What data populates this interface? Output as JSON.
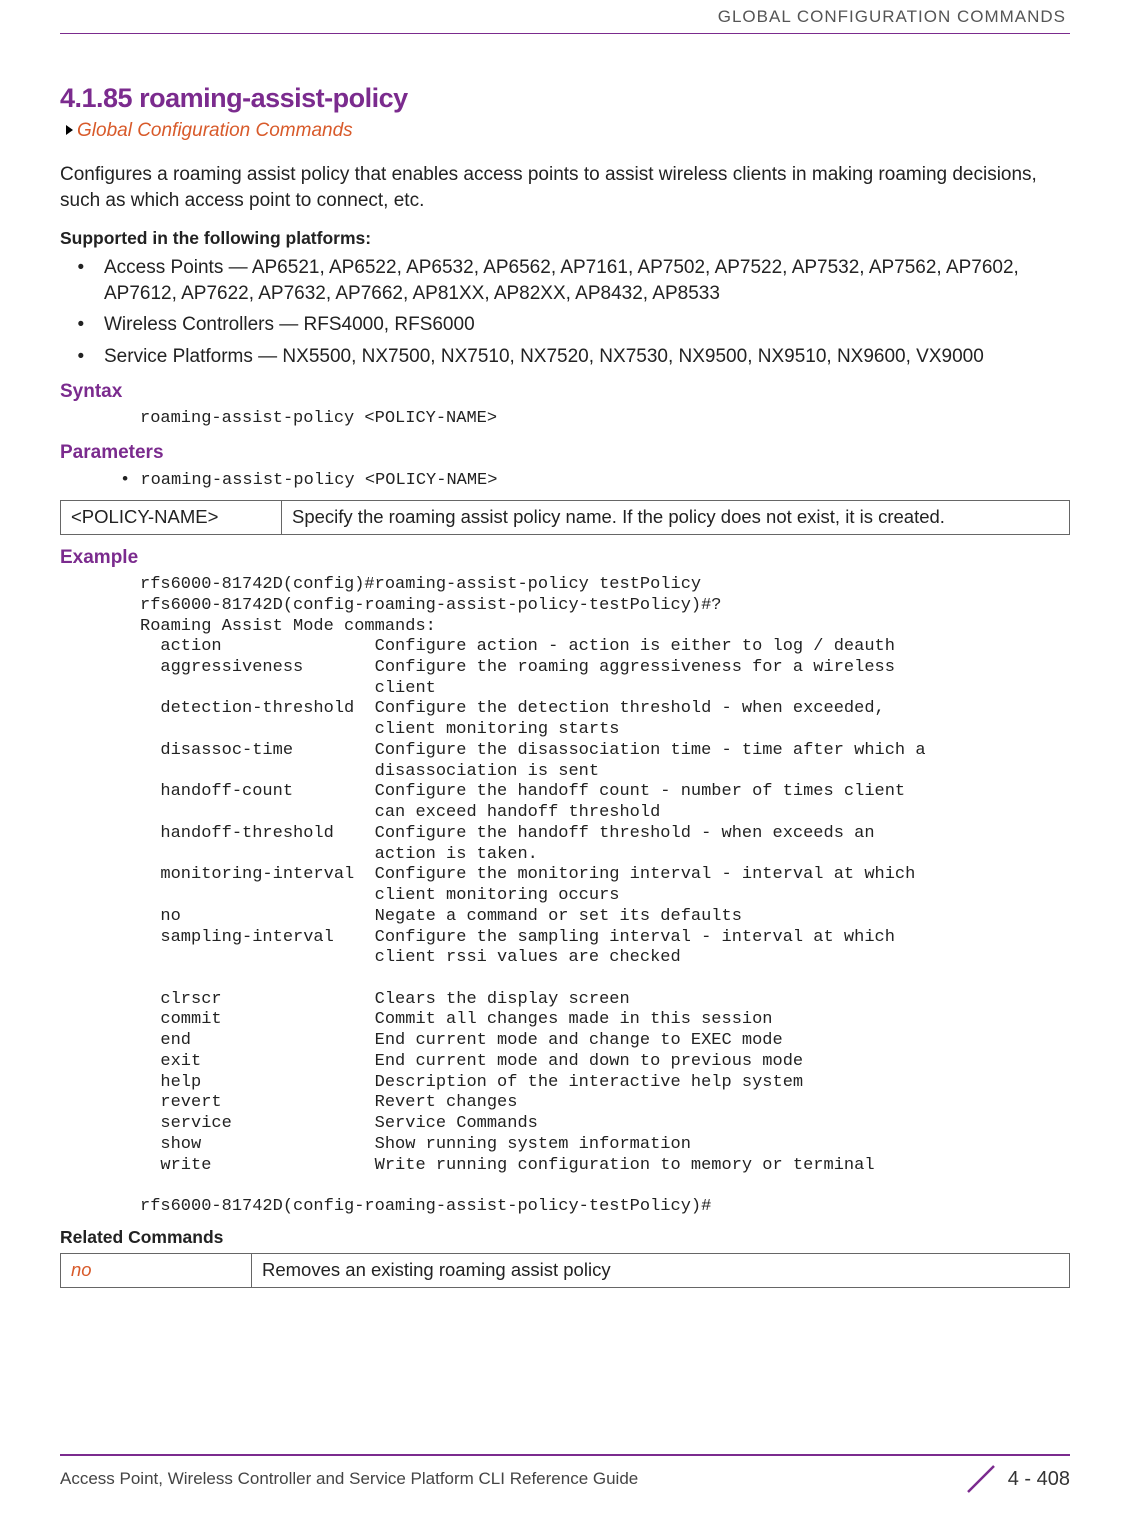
{
  "header": "GLOBAL CONFIGURATION COMMANDS",
  "title": "4.1.85 roaming-assist-policy",
  "breadcrumb": "Global Configuration Commands",
  "intro": "Configures a roaming assist policy that enables access points to assist wireless clients in making roaming decisions, such as which access point to connect, etc.",
  "supported_heading": "Supported in the following platforms:",
  "platforms": [
    "Access Points — AP6521, AP6522, AP6532, AP6562, AP7161, AP7502, AP7522, AP7532, AP7562, AP7602, AP7612, AP7622, AP7632, AP7662, AP81XX, AP82XX, AP8432, AP8533",
    "Wireless Controllers — RFS4000, RFS6000",
    "Service Platforms — NX5500, NX7500, NX7510, NX7520, NX7530, NX9500, NX9510, NX9600, VX9000"
  ],
  "syntax_heading": "Syntax",
  "syntax_code": "roaming-assist-policy <POLICY-NAME>",
  "parameters_heading": "Parameters",
  "parameters_bullet": "• roaming-assist-policy <POLICY-NAME>",
  "param_key": "<POLICY-NAME>",
  "param_desc": "Specify the roaming assist policy name. If the policy does not exist, it is created.",
  "example_heading": "Example",
  "example_code": "rfs6000-81742D(config)#roaming-assist-policy testPolicy\nrfs6000-81742D(config-roaming-assist-policy-testPolicy)#?\nRoaming Assist Mode commands:\n  action               Configure action - action is either to log / deauth\n  aggressiveness       Configure the roaming aggressiveness for a wireless\n                       client\n  detection-threshold  Configure the detection threshold - when exceeded,\n                       client monitoring starts\n  disassoc-time        Configure the disassociation time - time after which a\n                       disassociation is sent\n  handoff-count        Configure the handoff count - number of times client\n                       can exceed handoff threshold\n  handoff-threshold    Configure the handoff threshold - when exceeds an\n                       action is taken.\n  monitoring-interval  Configure the monitoring interval - interval at which\n                       client monitoring occurs\n  no                   Negate a command or set its defaults\n  sampling-interval    Configure the sampling interval - interval at which\n                       client rssi values are checked\n\n  clrscr               Clears the display screen\n  commit               Commit all changes made in this session\n  end                  End current mode and change to EXEC mode\n  exit                 End current mode and down to previous mode\n  help                 Description of the interactive help system\n  revert               Revert changes\n  service              Service Commands\n  show                 Show running system information\n  write                Write running configuration to memory or terminal\n\nrfs6000-81742D(config-roaming-assist-policy-testPolicy)#",
  "related_heading": "Related Commands",
  "related_key": "no",
  "related_desc": "Removes an existing roaming assist policy",
  "footer_text": "Access Point, Wireless Controller and Service Platform CLI Reference Guide",
  "page_number": "4 - 408"
}
